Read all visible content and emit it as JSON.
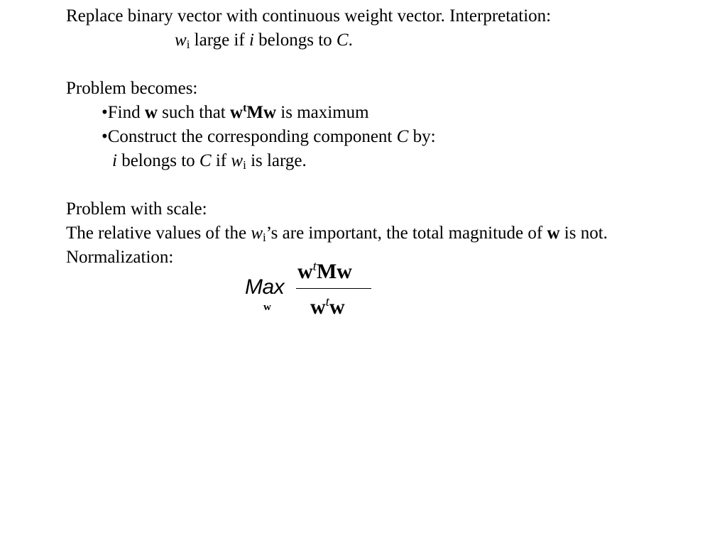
{
  "slide": {
    "intro": {
      "line1": "Replace binary vector with continuous weight vector. Interpretation:",
      "interp_w": "w",
      "interp_sub": "i",
      "interp_mid": " large if ",
      "interp_i": "i",
      "interp_belongs": " belongs to ",
      "interp_C": "C",
      "interp_end": "."
    },
    "problem_becomes": {
      "heading": "Problem becomes:",
      "bullet1_prefix": "•Find ",
      "bullet1_w": "w",
      "bullet1_mid": " such that ",
      "bullet1_w2": "w",
      "bullet1_sup": "t",
      "bullet1_Mw": "Mw",
      "bullet1_end": " is maximum",
      "bullet2_prefix": "•Construct the corresponding component ",
      "bullet2_C": "C",
      "bullet2_end": " by:",
      "cont_i": "i",
      "cont_belongs": " belongs to ",
      "cont_C": "C",
      "cont_if": " if ",
      "cont_w": "w",
      "cont_sub": "i",
      "cont_end": " is large."
    },
    "scale": {
      "heading": "Problem with scale:",
      "line_prefix": "The relative values of the ",
      "line_w": "w",
      "line_sub": "i",
      "line_mid": "’s are important, the total magnitude of ",
      "line_w2": "w",
      "line_end": " is not.",
      "normalization": "Normalization:"
    },
    "formula": {
      "operator": "Max",
      "operator_sub": "w",
      "numerator_w": "w",
      "numerator_sup": "t",
      "numerator_rest": "Mw",
      "denominator_w": "w",
      "denominator_sup": "t",
      "denominator_rest": "w"
    }
  }
}
